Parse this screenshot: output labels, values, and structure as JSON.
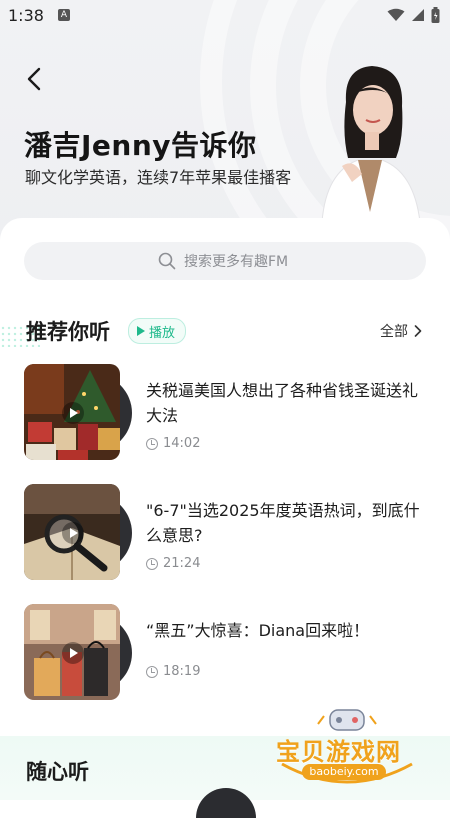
{
  "status": {
    "time": "1:38",
    "badge": "A"
  },
  "hero": {
    "title": "潘吉Jenny告诉你",
    "subtitle": "聊文化学英语，连续7年苹果最佳播客"
  },
  "search": {
    "placeholder": "搜索更多有趣FM"
  },
  "recommend": {
    "title": "推荐你听",
    "play_label": "播放",
    "all_label": "全部",
    "items": [
      {
        "title": "关税逼美国人想出了各种省钱圣诞送礼大法",
        "duration": "14:02"
      },
      {
        "title": "\"6-7\"当选2025年度英语热词，到底什么意思?",
        "duration": "21:24"
      },
      {
        "title": "“黑五”大惊喜：Diana回来啦！",
        "duration": "18:19"
      }
    ]
  },
  "random": {
    "title": "随心听"
  },
  "watermark": {
    "text": "宝贝游戏网",
    "url": "baobeiy.com"
  },
  "colors": {
    "accent": "#1eb98b",
    "watermark": "#f0a21c"
  }
}
